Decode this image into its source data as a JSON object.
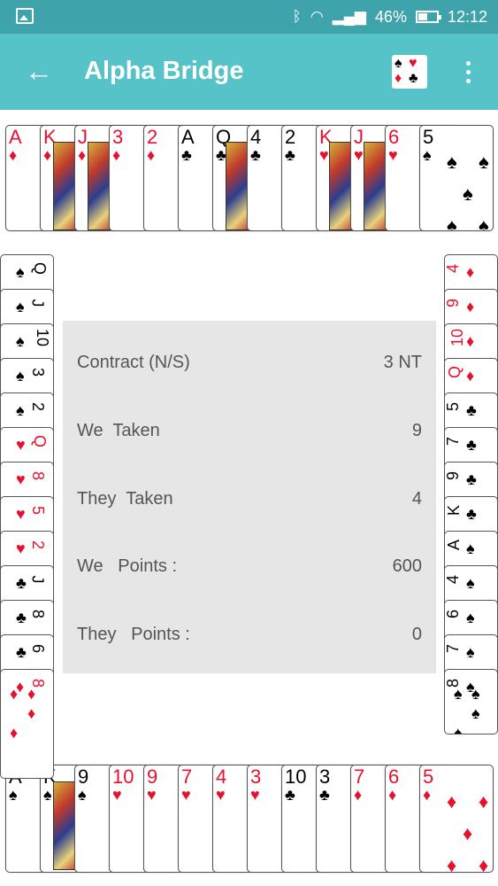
{
  "status_bar": {
    "battery": "46%",
    "time": "12:12",
    "icons": [
      "image-icon",
      "bluetooth-icon",
      "wifi-icon",
      "signal-icon",
      "battery-icon"
    ]
  },
  "app_bar": {
    "title": "Alpha Bridge",
    "back_icon": "back-arrow-icon",
    "cards_icon": "cards-icon",
    "more_icon": "more-vert-icon"
  },
  "score": {
    "rows": [
      {
        "label": "Contract (N/S)",
        "value": "3 NT"
      },
      {
        "label": "We  Taken",
        "value": "9"
      },
      {
        "label": "They  Taken",
        "value": "4"
      },
      {
        "label": "We   Points :",
        "value": "600"
      },
      {
        "label": "They   Points :",
        "value": "0"
      }
    ]
  },
  "hands": {
    "north": [
      {
        "rank": "A",
        "suit": "♦",
        "color": "red"
      },
      {
        "rank": "K",
        "suit": "♦",
        "color": "red",
        "face": true
      },
      {
        "rank": "J",
        "suit": "♦",
        "color": "red",
        "face": true
      },
      {
        "rank": "3",
        "suit": "♦",
        "color": "red"
      },
      {
        "rank": "2",
        "suit": "♦",
        "color": "red"
      },
      {
        "rank": "A",
        "suit": "♣",
        "color": "black"
      },
      {
        "rank": "Q",
        "suit": "♣",
        "color": "black",
        "face": true
      },
      {
        "rank": "4",
        "suit": "♣",
        "color": "black"
      },
      {
        "rank": "2",
        "suit": "♣",
        "color": "black"
      },
      {
        "rank": "K",
        "suit": "♥",
        "color": "red",
        "face": true
      },
      {
        "rank": "J",
        "suit": "♥",
        "color": "red",
        "face": true
      },
      {
        "rank": "6",
        "suit": "♥",
        "color": "red"
      },
      {
        "rank": "5",
        "suit": "♠",
        "color": "black"
      }
    ],
    "south": [
      {
        "rank": "A",
        "suit": "♠",
        "color": "black"
      },
      {
        "rank": "K",
        "suit": "♠",
        "color": "black",
        "face": true
      },
      {
        "rank": "9",
        "suit": "♠",
        "color": "black"
      },
      {
        "rank": "10",
        "suit": "♥",
        "color": "red"
      },
      {
        "rank": "9",
        "suit": "♥",
        "color": "red"
      },
      {
        "rank": "7",
        "suit": "♥",
        "color": "red"
      },
      {
        "rank": "4",
        "suit": "♥",
        "color": "red"
      },
      {
        "rank": "3",
        "suit": "♥",
        "color": "red"
      },
      {
        "rank": "10",
        "suit": "♣",
        "color": "black"
      },
      {
        "rank": "3",
        "suit": "♣",
        "color": "black"
      },
      {
        "rank": "7",
        "suit": "♦",
        "color": "red"
      },
      {
        "rank": "6",
        "suit": "♦",
        "color": "red"
      },
      {
        "rank": "5",
        "suit": "♦",
        "color": "red"
      }
    ],
    "west": [
      {
        "rank": "Q",
        "suit": "♠",
        "color": "black"
      },
      {
        "rank": "J",
        "suit": "♠",
        "color": "black"
      },
      {
        "rank": "10",
        "suit": "♠",
        "color": "black"
      },
      {
        "rank": "3",
        "suit": "♠",
        "color": "black"
      },
      {
        "rank": "2",
        "suit": "♠",
        "color": "black"
      },
      {
        "rank": "Q",
        "suit": "♥",
        "color": "red"
      },
      {
        "rank": "8",
        "suit": "♥",
        "color": "red"
      },
      {
        "rank": "5",
        "suit": "♥",
        "color": "red"
      },
      {
        "rank": "2",
        "suit": "♥",
        "color": "red"
      },
      {
        "rank": "J",
        "suit": "♣",
        "color": "black"
      },
      {
        "rank": "8",
        "suit": "♣",
        "color": "black"
      },
      {
        "rank": "6",
        "suit": "♣",
        "color": "black"
      },
      {
        "rank": "8",
        "suit": "♦",
        "color": "red"
      }
    ],
    "east": [
      {
        "rank": "4",
        "suit": "♦",
        "color": "red"
      },
      {
        "rank": "9",
        "suit": "♦",
        "color": "red"
      },
      {
        "rank": "10",
        "suit": "♦",
        "color": "red"
      },
      {
        "rank": "Q",
        "suit": "♦",
        "color": "red"
      },
      {
        "rank": "5",
        "suit": "♣",
        "color": "black"
      },
      {
        "rank": "7",
        "suit": "♣",
        "color": "black"
      },
      {
        "rank": "9",
        "suit": "♣",
        "color": "black"
      },
      {
        "rank": "K",
        "suit": "♣",
        "color": "black"
      },
      {
        "rank": "A",
        "suit": "♠",
        "color": "black"
      },
      {
        "rank": "4",
        "suit": "♠",
        "color": "black"
      },
      {
        "rank": "6",
        "suit": "♠",
        "color": "black"
      },
      {
        "rank": "7",
        "suit": "♠",
        "color": "black"
      },
      {
        "rank": "8",
        "suit": "♠",
        "color": "black"
      }
    ]
  },
  "colors": {
    "status_bar": "#3fa3ab",
    "app_bar": "#56c3c9",
    "panel": "#e6e6e6",
    "red_suit": "#e8112d",
    "black_suit": "#000000"
  }
}
